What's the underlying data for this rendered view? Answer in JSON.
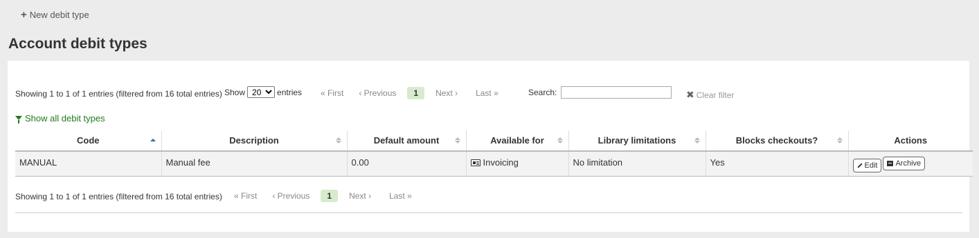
{
  "toolbar": {
    "new_label": "New debit type",
    "plus_icon": "plus-icon"
  },
  "page": {
    "title": "Account debit types"
  },
  "top_controls": {
    "info": "Showing 1 to 1 of 1 entries (filtered from 16 total entries)",
    "show_label": "Show",
    "entries_label": "entries",
    "length_selected": "20",
    "length_options": [
      "20"
    ],
    "search_label": "Search:",
    "search_value": "",
    "clear_filter": "Clear filter",
    "show_all": "Show all debit types"
  },
  "pager": {
    "first": "« First",
    "previous": "‹ Previous",
    "current": "1",
    "next": "Next ›",
    "last": "Last »"
  },
  "table": {
    "headers": [
      "Code",
      "Description",
      "Default amount",
      "Available for",
      "Library limitations",
      "Blocks checkouts?",
      "Actions"
    ],
    "rows": [
      {
        "code": "MANUAL",
        "description": "Manual fee",
        "default_amount": "0.00",
        "available_for": "Invoicing",
        "library_limitations": "No limitation",
        "blocks_checkouts": "Yes",
        "edit_label": "Edit",
        "archive_label": "Archive"
      }
    ]
  },
  "bottom_controls": {
    "info": "Showing 1 to 1 of 1 entries (filtered from 16 total entries)"
  },
  "colors": {
    "accent_green": "#217a1d",
    "current_page_bg": "#d8ebcc",
    "page_bg": "#ececec"
  }
}
